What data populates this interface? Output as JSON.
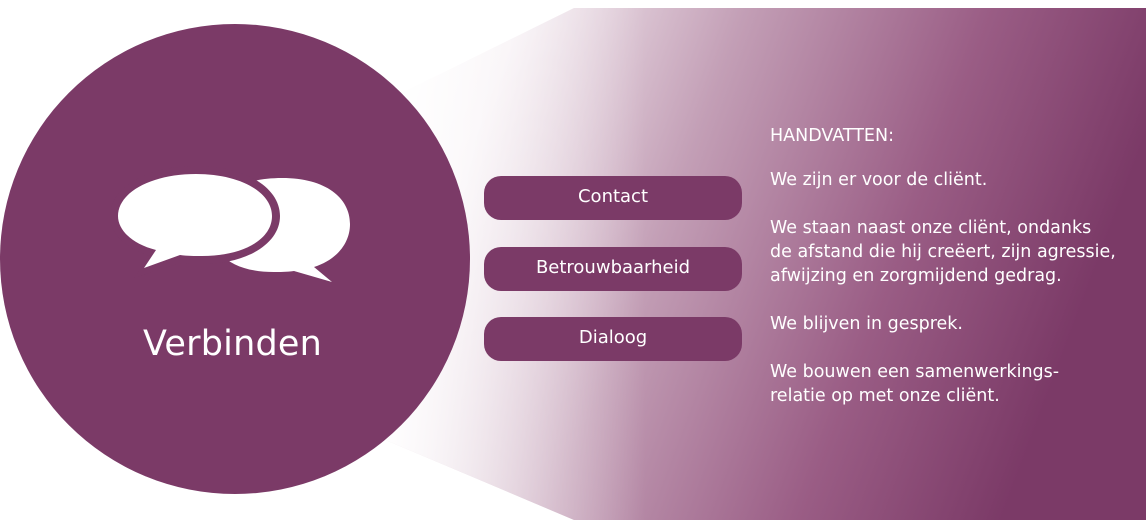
{
  "colors": {
    "primary": "#7b3a67",
    "gradient_start": "#ffffff",
    "gradient_end": "#7b3a67",
    "text": "#ffffff"
  },
  "circle": {
    "icon": "speech-bubbles-icon",
    "title": "Verbinden"
  },
  "pills": [
    {
      "label": "Contact"
    },
    {
      "label": "Betrouwbaarheid"
    },
    {
      "label": "Dialoog"
    }
  ],
  "handvatten": {
    "heading": "HANDVATTEN:",
    "paragraphs": [
      "We zijn er voor de cliënt.",
      "We staan naast onze cliënt, ondanks\nde afstand die hij creëert, zijn agressie,\nafwijzing en zorgmijdend gedrag.",
      "We blijven in gesprek.",
      "We bouwen een samenwerkings-\nrelatie op met onze cliënt."
    ]
  }
}
